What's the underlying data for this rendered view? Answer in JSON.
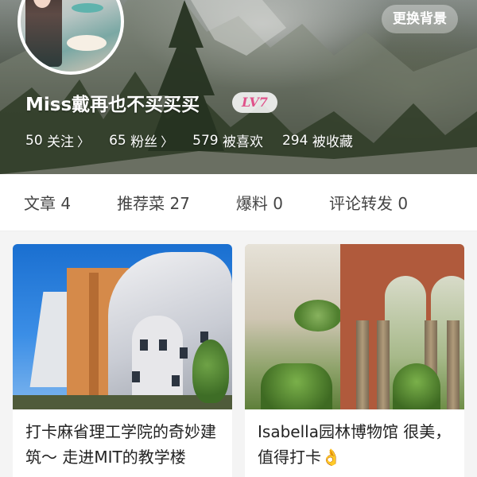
{
  "header": {
    "change_background_label": "更换背景",
    "username": "Miss戴再也不买买买",
    "level_badge": "LV7",
    "stats": [
      {
        "value": "50",
        "label": "关注",
        "chevron": "〉"
      },
      {
        "value": "65",
        "label": "粉丝",
        "chevron": "〉"
      },
      {
        "value": "579",
        "label": "被喜欢",
        "chevron": ""
      },
      {
        "value": "294",
        "label": "被收藏",
        "chevron": ""
      }
    ]
  },
  "tabs": [
    {
      "label": "文章 4"
    },
    {
      "label": "推荐菜 27"
    },
    {
      "label": "爆料 0"
    },
    {
      "label": "评论转发 0"
    }
  ],
  "cards": [
    {
      "title": "打卡麻省理工学院的奇妙建筑～ 走进MIT的教学楼"
    },
    {
      "title": "Isabella园林博物馆 很美，值得打卡👌"
    }
  ],
  "colors": {
    "level_badge_text": "#e0528a",
    "tab_text": "#444444",
    "page_background": "#f4f4f4"
  }
}
